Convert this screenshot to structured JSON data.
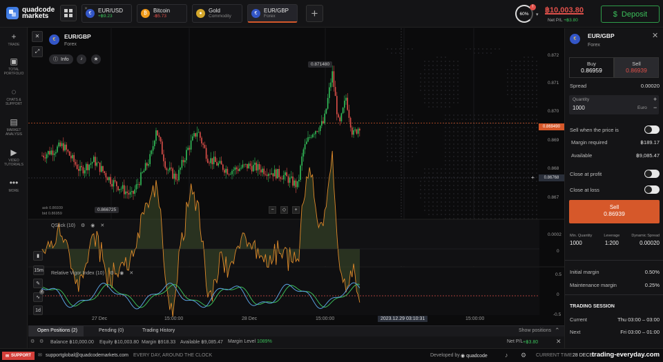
{
  "brand": {
    "line1": "quadcode",
    "line2": "markets"
  },
  "tabs": [
    {
      "name": "EUR/USD",
      "sub": "+฿9.23",
      "sub_color": "#3bbf5a",
      "icon": "eu-us-flag-icon"
    },
    {
      "name": "Bitcoin",
      "sub": "-฿5.73",
      "sub_color": "#e0504a",
      "icon": "bitcoin-icon"
    },
    {
      "name": "Gold",
      "sub": "Commodity",
      "sub_color": "#888888",
      "icon": "gold-icon"
    },
    {
      "name": "EUR/GBP",
      "sub": "Forex",
      "sub_color": "#888888",
      "icon": "eu-gb-flag-icon"
    }
  ],
  "account": {
    "level": "60%",
    "badge": "!",
    "balance": "฿10,003.80",
    "pnl_label": "Net P/L",
    "pnl": "+฿3.80",
    "deposit": "Deposit"
  },
  "sidebar": [
    {
      "icon": "plus-icon",
      "label": "TRADE"
    },
    {
      "icon": "portfolio-icon",
      "label": "TOTAL PORTFOLIO"
    },
    {
      "icon": "chat-icon",
      "label": "CHATS & SUPPORT"
    },
    {
      "icon": "analysis-icon",
      "label": "MARKET ANALYSIS"
    },
    {
      "icon": "video-icon",
      "label": "VIDEO TUTORIALS"
    },
    {
      "icon": "more-icon",
      "label": "MORE"
    }
  ],
  "chart": {
    "asset": "EUR/GBP",
    "type": "Forex",
    "info": "Info",
    "ask": "ask 0.86939",
    "bid": "bid 0.86959",
    "high_label": "0.871480",
    "low_label": "0.866725",
    "current_price": "0.869490",
    "cursor_price": "0.86768",
    "price_ticks": [
      "0.872",
      "0.871",
      "0.870",
      "0.869",
      "0.868",
      "0.867"
    ],
    "time_ticks": [
      "27 Dec",
      "15:00:00",
      "28 Dec",
      "15:00:00",
      "15:00:00"
    ],
    "cursor_time": "2023.12.29 03:10:31",
    "indicators": [
      {
        "name": "QStick (10)",
        "ticks": [
          "0.0002",
          "0"
        ]
      },
      {
        "name": "Relative Vigor Index (10)",
        "ticks": [
          "0.5",
          "0",
          "-0.5"
        ]
      }
    ],
    "timeframe": "15m",
    "period": "1d",
    "tool_badge": "2",
    "zoom_controls": [
      "−",
      "◇",
      "+"
    ]
  },
  "chart_data": {
    "type": "candlestick",
    "ylim": [
      0.8665,
      0.8722
    ],
    "current": 0.86949,
    "high": 0.87148,
    "low": 0.866725
  },
  "trade": {
    "asset": "EUR/GBP",
    "type": "Forex",
    "buy_label": "Buy",
    "buy_price": "0.86959",
    "sell_label": "Sell",
    "sell_price": "0.86939",
    "spread_label": "Spread",
    "spread": "0.00020",
    "qty_label": "Quantity",
    "qty": "1000",
    "qty_unit": "Euro",
    "sell_when_label": "Sell when the price is",
    "margin_req_label": "Margin required",
    "margin_req": "฿189.17",
    "available_label": "Available",
    "available": "฿9,085.47",
    "close_profit_label": "Close at profit",
    "close_loss_label": "Close at loss",
    "action_label": "Sell",
    "action_price": "0.86939",
    "stats": [
      {
        "label": "Min. Quantity",
        "value": "1000"
      },
      {
        "label": "Leverage",
        "value": "1:200"
      },
      {
        "label": "Dynamic Spread",
        "value": "0.00020"
      }
    ],
    "initial_margin_label": "Initial margin",
    "initial_margin": "0.50%",
    "maint_margin_label": "Maintenance margin",
    "maint_margin": "0.25%",
    "session_title": "TRADING SESSION",
    "current_label": "Current",
    "current_session": "Thu 03:00 – 03:00",
    "next_label": "Next",
    "next_session": "Fri 03:00 – 01:00"
  },
  "bottom": {
    "tabs": [
      "Open Positions (2)",
      "Pending (0)",
      "Trading History"
    ],
    "show_positions": "Show positions",
    "balance": "Balance ฿10,000.00",
    "equity": "Equity ฿10,003.80",
    "margin": "Margin ฿918.33",
    "available": "Available ฿9,085.47",
    "margin_level_label": "Margin Level",
    "margin_level": "1089%",
    "net_pl": "Net P/L",
    "net_pl_value": "+฿3.80"
  },
  "footer": {
    "support": "SUPPORT",
    "email": "supportglobal@quadcodemarkets.com",
    "tagline": "EVERY DAY, AROUND THE CLOCK",
    "developed": "Developed by",
    "dev_brand": "quadcode",
    "time_label": "CURRENT TIME:",
    "time_value": "28 DECE",
    "watermark": "trading-everyday.com"
  }
}
